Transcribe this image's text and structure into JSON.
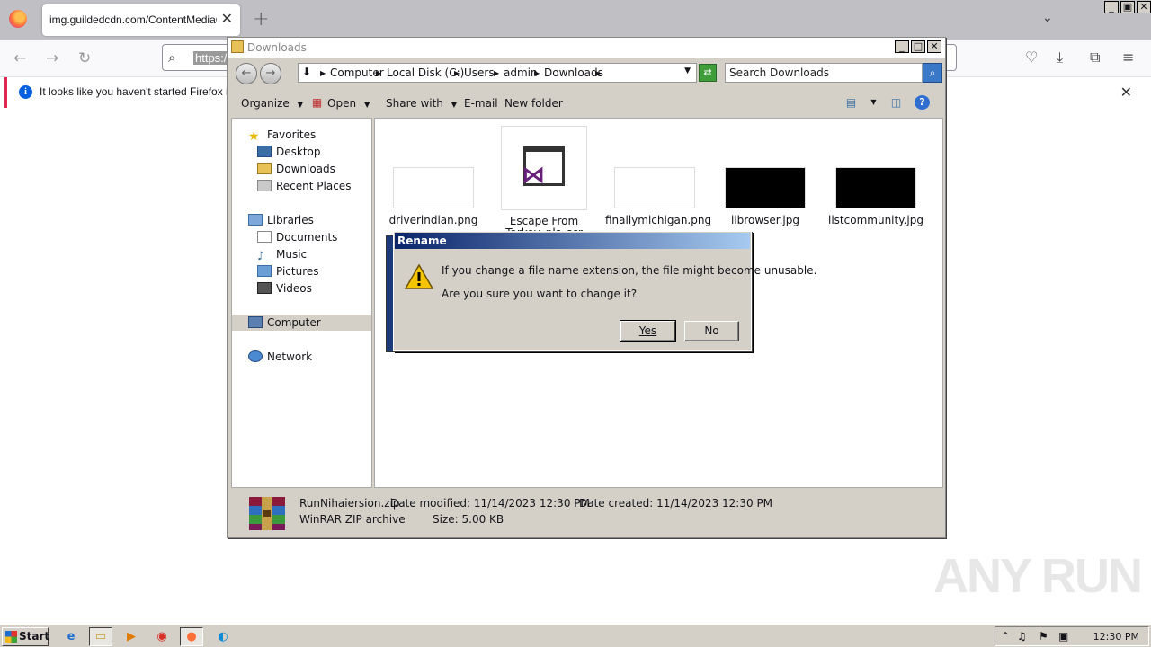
{
  "browser": {
    "tab_title": "img.guildedcdn.com/ContentMediaGenericFiles",
    "url_text": "https://",
    "notice_text": "It looks like you haven't started Firefox in a"
  },
  "explorer": {
    "title": "Downloads",
    "breadcrumbs": [
      "Computer",
      "Local Disk (C:)",
      "Users",
      "admin",
      "Downloads"
    ],
    "search_placeholder": "Search Downloads",
    "toolbar": {
      "organize": "Organize",
      "open": "Open",
      "share_with": "Share with",
      "email": "E-mail",
      "new_folder": "New folder"
    },
    "nav": {
      "favorites": "Favorites",
      "desktop": "Desktop",
      "downloads": "Downloads",
      "recent_places": "Recent Places",
      "libraries": "Libraries",
      "documents": "Documents",
      "music": "Music",
      "pictures": "Pictures",
      "videos": "Videos",
      "computer": "Computer",
      "network": "Network"
    },
    "files": [
      {
        "name": "driverindian.png"
      },
      {
        "name": "Escape From Tarkov_pls_scr"
      },
      {
        "name": "finallymichigan.png"
      },
      {
        "name": "iibrowser.jpg"
      },
      {
        "name": "listcommunity.jpg"
      }
    ],
    "details": {
      "file_name": "RunNihaiersion.zip",
      "file_type": "WinRAR ZIP archive",
      "date_modified": "Date modified: 11/14/2023 12:30 PM",
      "size": "Size: 5.00 KB",
      "date_created": "Date created: 11/14/2023 12:30 PM"
    }
  },
  "dialog": {
    "title": "Rename",
    "message_line1": "If you change a file name extension, the file might become unusable.",
    "message_line2": "Are you sure you want to change it?",
    "yes_label": "Yes",
    "no_label": "No"
  },
  "taskbar": {
    "start_label": "Start",
    "clock": "12:30 PM"
  },
  "watermark": "ANY RUN",
  "colors": {
    "dialog_title_start": "#0a246a",
    "dialog_title_end": "#a6caf0",
    "notice_accent": "#e22850"
  }
}
